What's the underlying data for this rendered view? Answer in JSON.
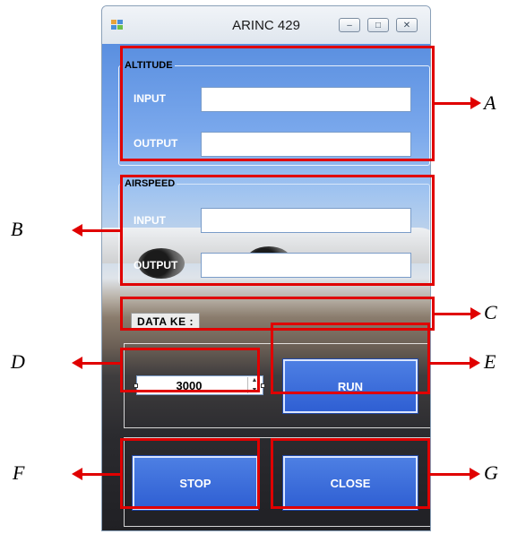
{
  "window": {
    "title": "ARINC 429",
    "minimize_glyph": "–",
    "maximize_glyph": "□",
    "close_glyph": "✕"
  },
  "altitude": {
    "legend": "ALTITUDE",
    "input_label": "INPUT",
    "input_value": "",
    "output_label": "OUTPUT",
    "output_value": ""
  },
  "airspeed": {
    "legend": "AIRSPEED",
    "input_label": "INPUT",
    "input_value": "",
    "output_label": "OUTPUT",
    "output_value": ""
  },
  "data_ke": {
    "label": "DATA  KE  :"
  },
  "numeric": {
    "value": "3000"
  },
  "buttons": {
    "run": "RUN",
    "stop": "STOP",
    "close": "CLOSE"
  },
  "annotations": {
    "a": "A",
    "b": "B",
    "c": "C",
    "d": "D",
    "e": "E",
    "f": "F",
    "g": "G"
  },
  "colors": {
    "annotation_red": "#e00000",
    "button_blue": "#2f5fd3"
  },
  "icons": {
    "app": "app-icon",
    "minimize": "minimize-icon",
    "maximize": "maximize-icon",
    "close": "close-icon",
    "spinner": "spinner-arrows-icon"
  }
}
